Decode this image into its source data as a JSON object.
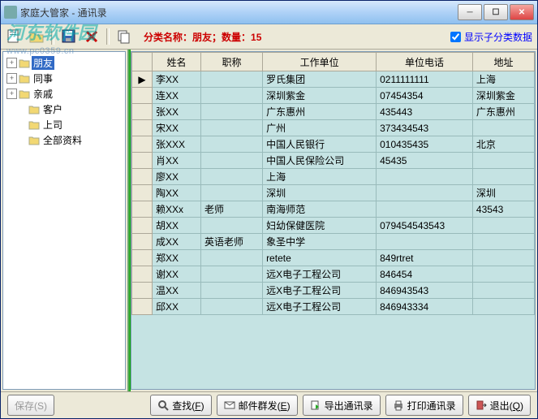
{
  "title": "家庭大管家 - 通讯录",
  "watermark": {
    "line1": "河东软件园",
    "line2": "www.pc0359.cn"
  },
  "category_label_prefix": "分类名称：",
  "category_name": "朋友",
  "count_prefix": "；数量：",
  "count_value": "15",
  "show_sub_checkbox": "显示子分类数据",
  "tree": [
    {
      "label": "朋友",
      "expandable": true,
      "selected": true
    },
    {
      "label": "同事",
      "expandable": true
    },
    {
      "label": "亲戚",
      "expandable": true
    },
    {
      "label": "客户",
      "expandable": false,
      "indent": 1
    },
    {
      "label": "上司",
      "expandable": false,
      "indent": 1
    },
    {
      "label": "全部资料",
      "expandable": false,
      "indent": 1
    }
  ],
  "columns": [
    "姓名",
    "职称",
    "工作单位",
    "单位电话",
    "地址"
  ],
  "rows": [
    {
      "name": "李XX",
      "title": "",
      "org": "罗氏集团",
      "tel": "0211111111",
      "addr": "上海"
    },
    {
      "name": "连XX",
      "title": "",
      "org": "深圳紫金",
      "tel": "07454354",
      "addr": "深圳紫金"
    },
    {
      "name": "张XX",
      "title": "",
      "org": "广东惠州",
      "tel": "435443",
      "addr": "广东惠州"
    },
    {
      "name": "宋XX",
      "title": "",
      "org": "广州",
      "tel": "373434543",
      "addr": ""
    },
    {
      "name": "张XXX",
      "title": "",
      "org": "中国人民银行",
      "tel": "010435435",
      "addr": "北京"
    },
    {
      "name": "肖XX",
      "title": "",
      "org": "中国人民保险公司",
      "tel": "45435",
      "addr": ""
    },
    {
      "name": "廖XX",
      "title": "",
      "org": "上海",
      "tel": "",
      "addr": ""
    },
    {
      "name": "陶XX",
      "title": "",
      "org": "深圳",
      "tel": "",
      "addr": "深圳"
    },
    {
      "name": "赖XXx",
      "title": "老师",
      "org": "南海师范",
      "tel": "",
      "addr": "43543"
    },
    {
      "name": "胡XX",
      "title": "",
      "org": "妇幼保健医院",
      "tel": "079454543543",
      "addr": ""
    },
    {
      "name": "成XX",
      "title": "英语老师",
      "org": "象圣中学",
      "tel": "",
      "addr": ""
    },
    {
      "name": "郑XX",
      "title": "",
      "org": "retete",
      "tel": "849rtret",
      "addr": ""
    },
    {
      "name": "谢XX",
      "title": "",
      "org": "远X电子工程公司",
      "tel": "846454",
      "addr": ""
    },
    {
      "name": "温XX",
      "title": "",
      "org": "远X电子工程公司",
      "tel": "846943543",
      "addr": ""
    },
    {
      "name": "邱XX",
      "title": "",
      "org": "远X电子工程公司",
      "tel": "846943334",
      "addr": ""
    }
  ],
  "footer": {
    "save": "保存(S)",
    "find": "查找",
    "find_key": "F",
    "mail": "邮件群发",
    "mail_key": "E",
    "export": "导出通讯录",
    "print": "打印通讯录",
    "exit": "退出",
    "exit_key": "Q"
  }
}
